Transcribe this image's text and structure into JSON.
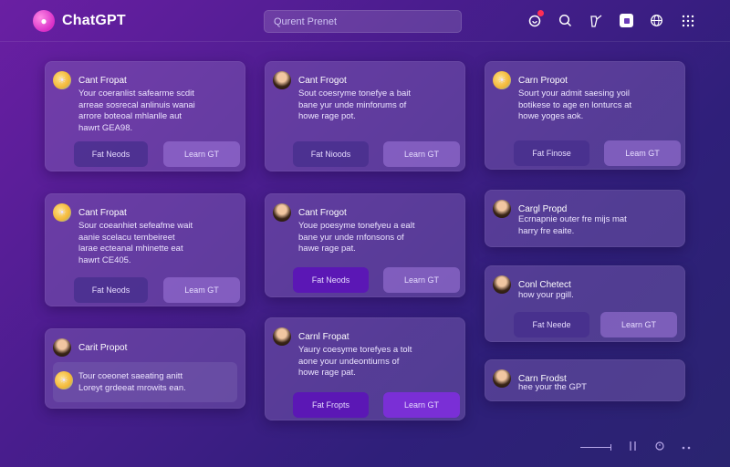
{
  "app": {
    "name": "ChatGPT",
    "logo_icon": "chat-bubble-icon"
  },
  "search": {
    "placeholder": "Qurent Prenet"
  },
  "top_icons": [
    "notification-icon",
    "search-icon",
    "share-icon",
    "square-app-icon",
    "globe-icon",
    "grid-menu-icon"
  ],
  "cards": [
    {
      "title": "Cant Fropat",
      "avatar": "bot",
      "lines": [
        "Your coeranlist safearme scdit",
        "arreae sosrecal anlinuis wanai",
        "arrore boteoal mhlanlle aut",
        "hawrt GEA98."
      ],
      "buttons": [
        "Fat Neods",
        "Learn GT"
      ]
    },
    {
      "title": "Cant Frogot",
      "avatar": "person",
      "lines": [
        "Sout coesryme tonefye a bait",
        "bane yur unde minforums of",
        "howe rage pot."
      ],
      "buttons": [
        "Fat Nioods",
        "Learn GT"
      ]
    },
    {
      "title": "Carn Propot",
      "avatar": "bot",
      "lines": [
        "Sourt your admit saesing yoil",
        "botikese to age en lonturcs at",
        "howe yoges aok."
      ],
      "buttons": [
        "Fat Finose",
        "Leam GT"
      ]
    },
    {
      "title": "Cant Fropat",
      "avatar": "bot",
      "lines": [
        "Sour coeanhiet sefeafme wait",
        "aanie scelacu tembeireet",
        "larae ecteanal mhinette eat",
        "hawrt CE405."
      ],
      "buttons": [
        "Fat Neods",
        "Leam GT"
      ]
    },
    {
      "title": "Cant Frogot",
      "avatar": "person",
      "lines": [
        "Youe poesyme tonefyeu a ealt",
        "bane yur unde rnfonsons of",
        "hawe rage pat."
      ],
      "buttons": [
        "Fat Neods",
        "Learn GT"
      ]
    },
    {
      "title": "Cargl Propd",
      "avatar": "person",
      "lines": [
        "Ecrnapnie outer fre mijs mat",
        "harry fre eaite."
      ],
      "buttons": []
    },
    {
      "title": "Conl Chetect",
      "avatar": "person",
      "lines": [
        "how your pgill."
      ],
      "buttons": [
        "Fat Neede",
        "Learn GT"
      ]
    },
    {
      "title": "Carit Propot",
      "avatar": "person",
      "inner": {
        "avatar": "bot",
        "lines": [
          "Tour coeonet saeating anitt",
          "Loreyt grdeeat mrowits ean."
        ]
      },
      "buttons": []
    },
    {
      "title": "Carnl Fropat",
      "avatar": "person",
      "lines": [
        "Yaury coesyme torefyes a tolt",
        "aone your undeontiurns of",
        "howe rage pat."
      ],
      "buttons": [
        "Fat Fropts",
        "Learn GT"
      ]
    },
    {
      "title": "Carn Frodst",
      "avatar": "person",
      "lines": [
        "hee your the GPT"
      ],
      "buttons": []
    }
  ],
  "bottombar": {
    "items": [
      "slider-control",
      "columns-icon",
      "clock-icon",
      "more-icon"
    ]
  }
}
